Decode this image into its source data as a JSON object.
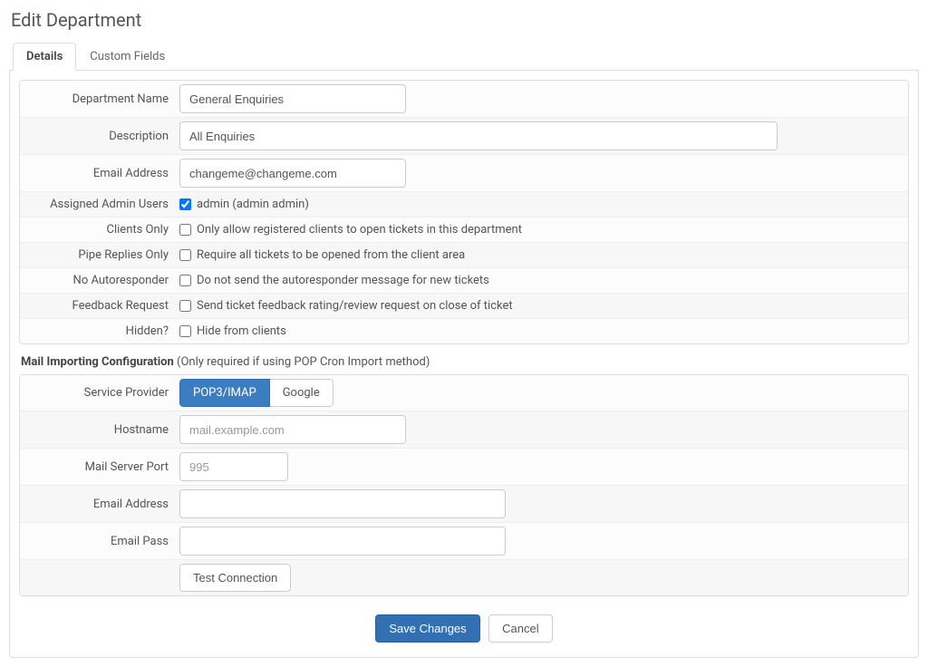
{
  "page": {
    "title": "Edit Department"
  },
  "tabs": {
    "details": "Details",
    "custom_fields": "Custom Fields"
  },
  "labels": {
    "department_name": "Department Name",
    "description": "Description",
    "email_address": "Email Address",
    "assigned_admin_users": "Assigned Admin Users",
    "clients_only": "Clients Only",
    "pipe_replies_only": "Pipe Replies Only",
    "no_autoresponder": "No Autoresponder",
    "feedback_request": "Feedback Request",
    "hidden": "Hidden?",
    "service_provider": "Service Provider",
    "hostname": "Hostname",
    "mail_server_port": "Mail Server Port",
    "mail_email_address": "Email Address",
    "email_pass": "Email Pass"
  },
  "values": {
    "department_name": "General Enquiries",
    "description": "All Enquiries",
    "email_address": "changeme@changeme.com",
    "admin_user": "admin (admin admin)",
    "hostname": "",
    "mail_port": "",
    "mail_email": "",
    "mail_pass": ""
  },
  "placeholders": {
    "hostname": "mail.example.com",
    "mail_port": "995"
  },
  "checkbox_text": {
    "clients_only": "Only allow registered clients to open tickets in this department",
    "pipe_replies_only": "Require all tickets to be opened from the client area",
    "no_autoresponder": "Do not send the autoresponder message for new tickets",
    "feedback_request": "Send ticket feedback rating/review request on close of ticket",
    "hidden": "Hide from clients"
  },
  "mail_section": {
    "title": "Mail Importing Configuration",
    "note": "(Only required if using POP Cron Import method)"
  },
  "service_provider": {
    "pop3": "POP3/IMAP",
    "google": "Google"
  },
  "buttons": {
    "test_connection": "Test Connection",
    "save_changes": "Save Changes",
    "cancel": "Cancel"
  }
}
